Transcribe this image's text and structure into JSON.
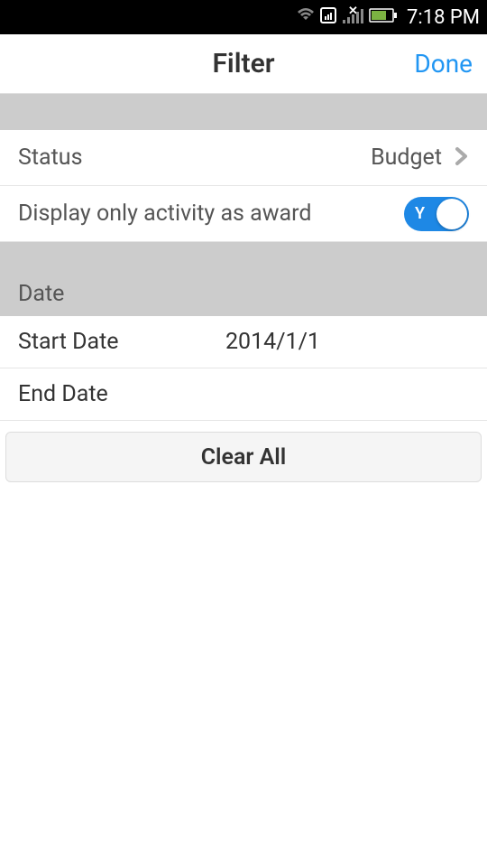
{
  "statusBar": {
    "time": "7:18 PM"
  },
  "header": {
    "title": "Filter",
    "done": "Done"
  },
  "status": {
    "label": "Status",
    "value": "Budget"
  },
  "displayAward": {
    "label": "Display only activity as award",
    "toggleText": "Y"
  },
  "dateSection": {
    "header": "Date",
    "startLabel": "Start Date",
    "startValue": "2014/1/1",
    "endLabel": "End Date",
    "endValue": ""
  },
  "clearAll": {
    "label": "Clear All"
  }
}
